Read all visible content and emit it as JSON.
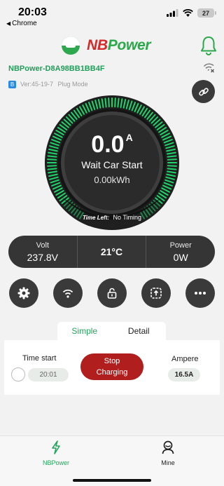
{
  "status_bar": {
    "time": "20:03",
    "back_label": "Chrome",
    "battery": "27"
  },
  "header": {
    "brand_nb": "NB",
    "brand_power": "Power"
  },
  "device": {
    "name": "NBPower-D8A98BB1BB4F",
    "bt_icon": "B",
    "version": "Ver:45-19-7",
    "mode": "Plug Mode"
  },
  "gauge": {
    "current": "0.0",
    "unit": "A",
    "state": "Wait Car Start",
    "energy": "0.00kWh",
    "time_left_label": "Time Left:",
    "time_left_value": "No Timing",
    "ring_color": "#1fd46a"
  },
  "stats": {
    "volt_label": "Volt",
    "volt_value": "237.8V",
    "temperature": "21°C",
    "power_label": "Power",
    "power_value": "0W"
  },
  "actions": [
    "settings-icon",
    "wifi-icon",
    "lock-open-icon",
    "upload-icon",
    "more-icon"
  ],
  "tabs": {
    "simple": "Simple",
    "detail": "Detail"
  },
  "panel": {
    "time_start_label": "Time start",
    "time_start_value": "20:01",
    "stop_line1": "Stop",
    "stop_line2": "Charging",
    "ampere_label": "Ampere",
    "ampere_value": "16.5A"
  },
  "nav": {
    "home_label": "NBPower",
    "mine_label": "Mine"
  },
  "colors": {
    "accent_green": "#25a55c",
    "stop_red": "#b11e1e",
    "dark": "#3a3a3a"
  }
}
